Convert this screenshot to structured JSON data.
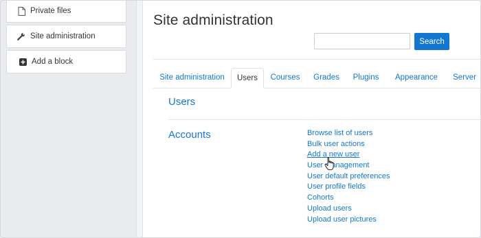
{
  "sidebar": {
    "items": [
      {
        "label": "Private files",
        "icon": "file-icon"
      },
      {
        "label": "Site administration",
        "icon": "wrench-icon"
      },
      {
        "label": "Add a block",
        "icon": "plus-square-icon"
      }
    ]
  },
  "header": {
    "title": "Site administration",
    "search": {
      "placeholder": "",
      "value": "",
      "button_label": "Search"
    }
  },
  "tabs": [
    {
      "label": "Site administration",
      "active": false
    },
    {
      "label": "Users",
      "active": true
    },
    {
      "label": "Courses",
      "active": false
    },
    {
      "label": "Grades",
      "active": false
    },
    {
      "label": "Plugins",
      "active": false
    },
    {
      "label": "Appearance",
      "active": false
    },
    {
      "label": "Server",
      "active": false
    }
  ],
  "content": {
    "section_heading": "Users",
    "category_heading": "Accounts",
    "links": [
      "Browse list of users",
      "Bulk user actions",
      "Add a new user",
      "User management",
      "User default preferences",
      "User profile fields",
      "Cohorts",
      "Upload users",
      "Upload user pictures"
    ]
  },
  "colors": {
    "accent": "#1177d1",
    "text": "#333333",
    "sidebar_bg": "#e9ebee"
  }
}
